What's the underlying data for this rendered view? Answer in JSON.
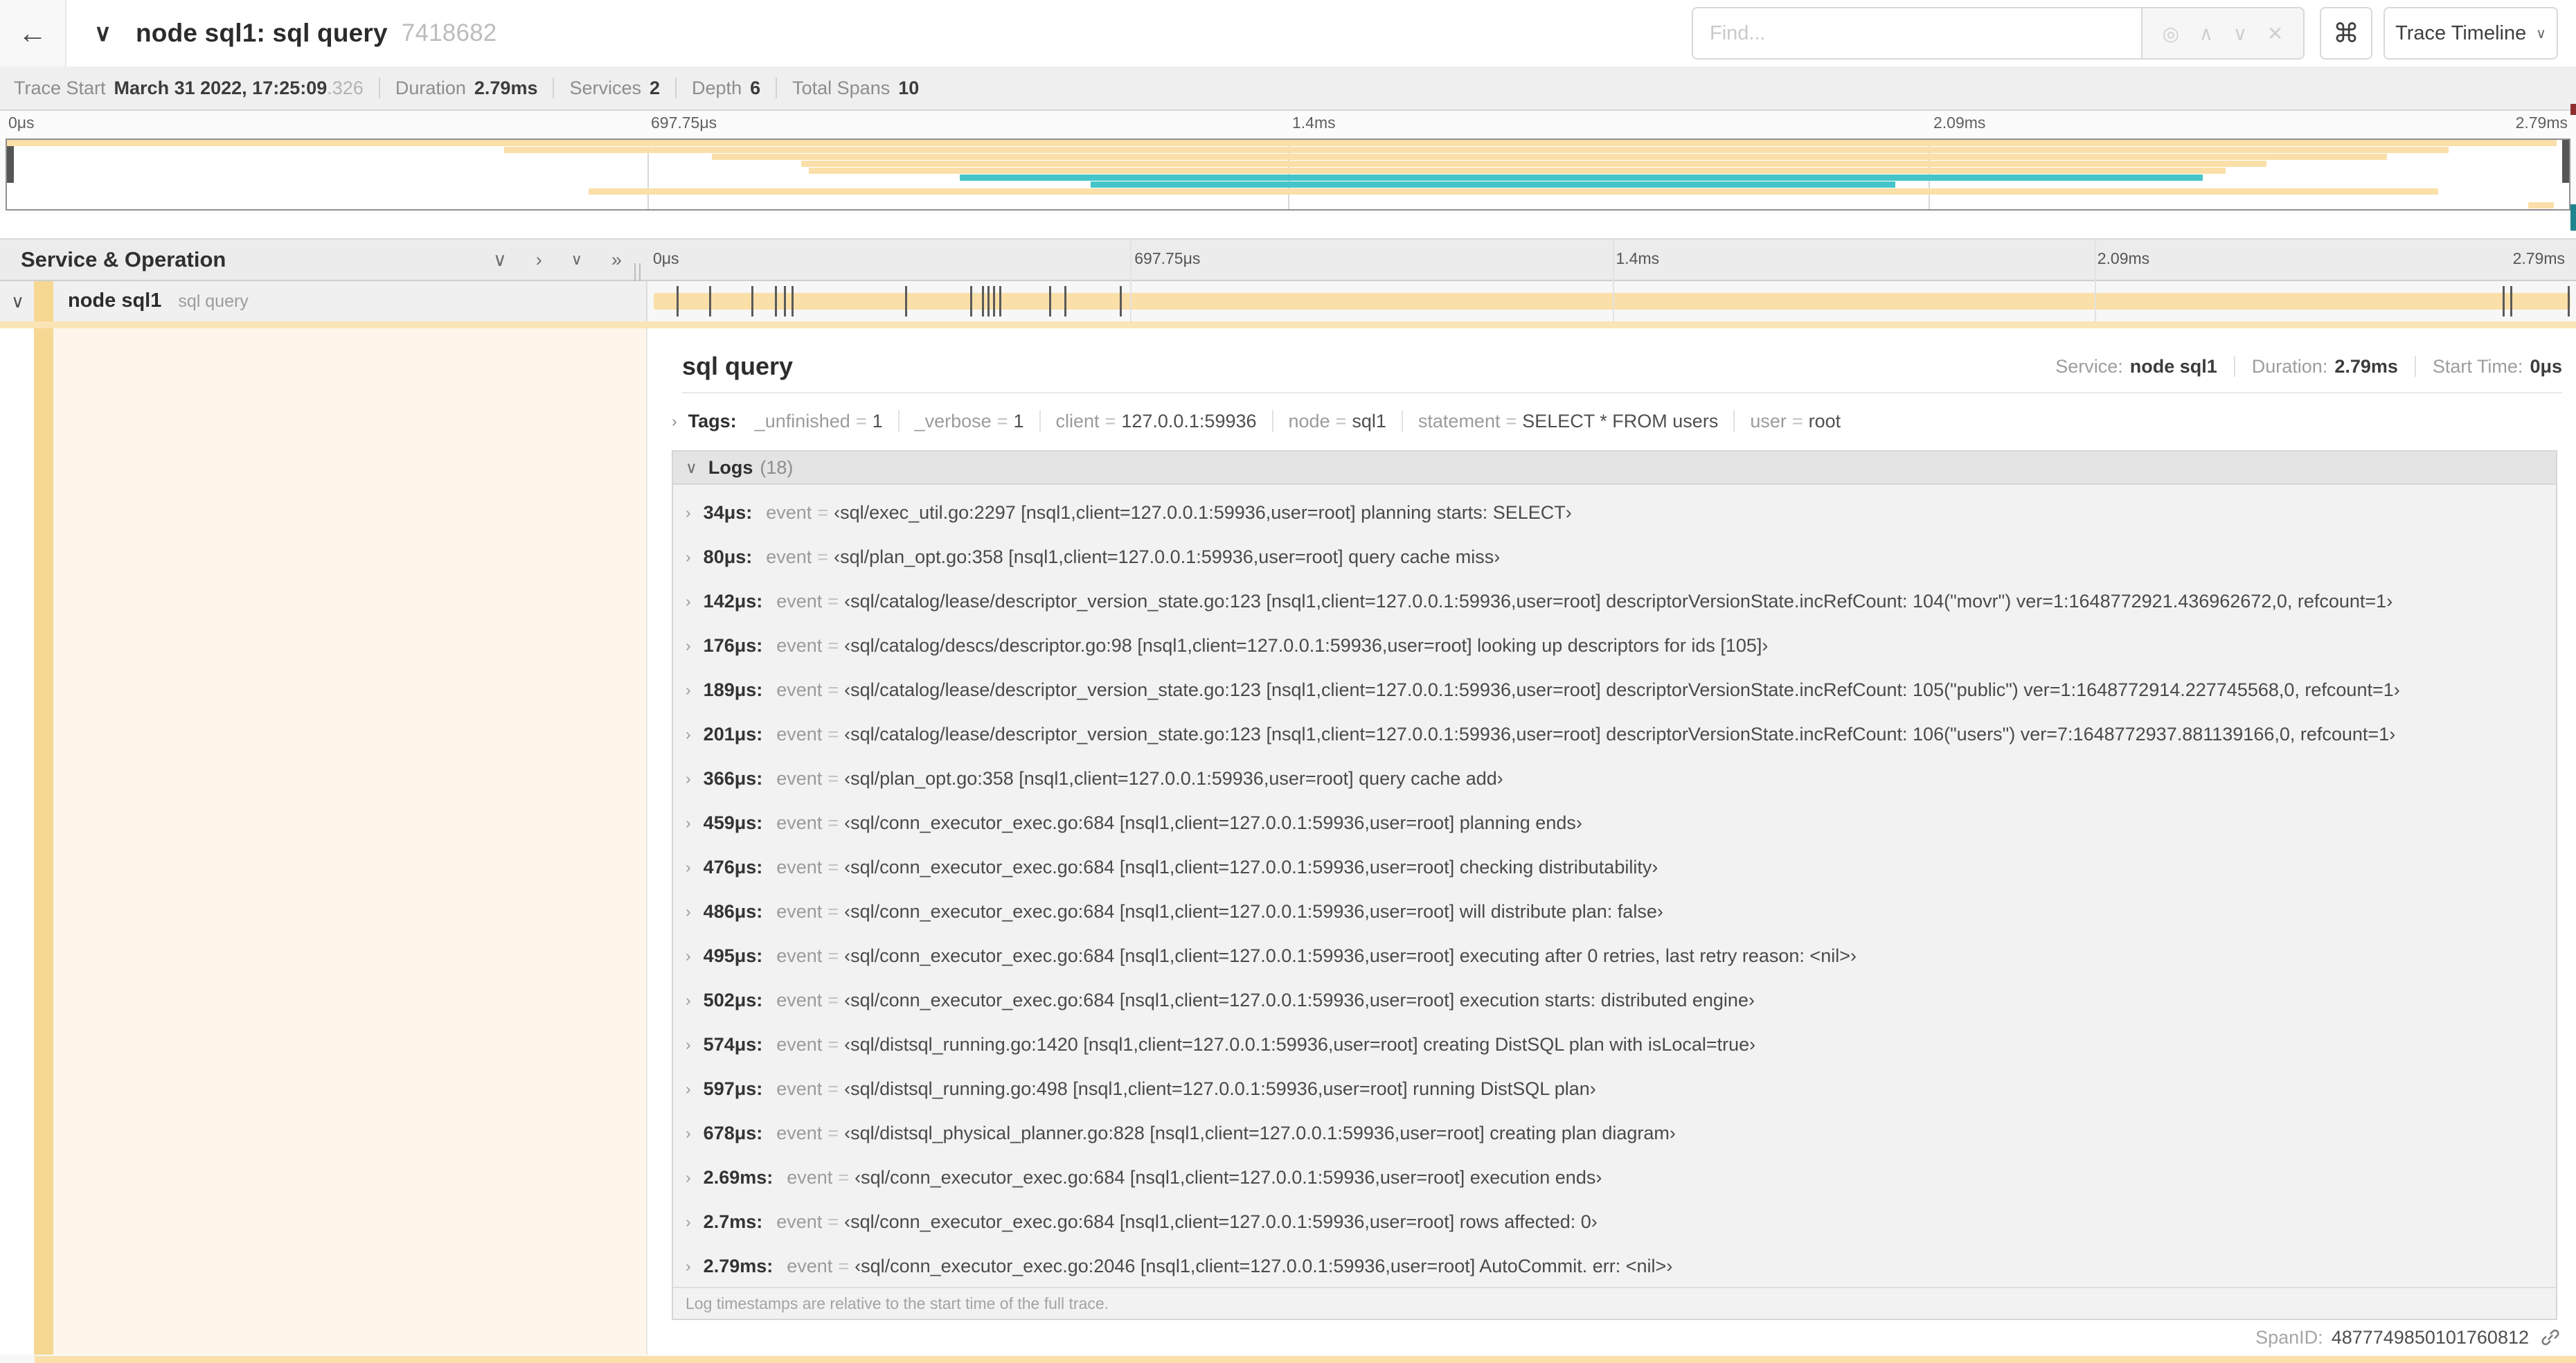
{
  "colors": {
    "yellow": "#fadfa9",
    "strip_yellow": "#f6d893",
    "teal": "#45c5c9",
    "cream": "#fff5ea"
  },
  "header": {
    "back_icon": "←",
    "collapse_icon": "∨",
    "title": "node sql1: sql query",
    "trace_id": "7418682",
    "find_placeholder": "Find...",
    "find_icons": [
      "◎",
      "∧",
      "∨",
      "✕"
    ],
    "shortcut_label": "⌘",
    "view_label": "Trace Timeline",
    "view_caret": "∨"
  },
  "summary": {
    "items": [
      {
        "label": "Trace Start",
        "value": "March 31 2022, 17:25:09",
        "suffix": ".326"
      },
      {
        "label": "Duration",
        "value": "2.79ms"
      },
      {
        "label": "Services",
        "value": "2"
      },
      {
        "label": "Depth",
        "value": "6"
      },
      {
        "label": "Total Spans",
        "value": "10"
      }
    ]
  },
  "minimap": {
    "ticks": [
      "0μs",
      "697.75μs",
      "1.4ms",
      "2.09ms",
      "2.79ms"
    ],
    "spans": [
      {
        "row": 0,
        "start": 0,
        "end": 99.5,
        "color": "yellow"
      },
      {
        "row": 1,
        "start": 19.4,
        "end": 95.3,
        "color": "yellow"
      },
      {
        "row": 2,
        "start": 27.5,
        "end": 92.9,
        "color": "yellow"
      },
      {
        "row": 3,
        "start": 31.0,
        "end": 88.2,
        "color": "yellow"
      },
      {
        "row": 4,
        "start": 31.3,
        "end": 86.6,
        "color": "yellow"
      },
      {
        "row": 5,
        "start": 37.2,
        "end": 85.7,
        "color": "teal"
      },
      {
        "row": 6,
        "start": 42.3,
        "end": 73.7,
        "color": "teal"
      },
      {
        "row": 7,
        "start": 22.7,
        "end": 94.9,
        "color": "yellow"
      },
      {
        "row": 9,
        "start": 98.4,
        "end": 99.4,
        "color": "yellow"
      }
    ]
  },
  "timeline": {
    "column_header": "Service & Operation",
    "collapse_icons": [
      "∨",
      "›",
      "∨∨",
      "»"
    ],
    "ticks": [
      "0μs",
      "697.75μs",
      "1.4ms",
      "2.09ms",
      "2.79ms"
    ],
    "row": {
      "collapse_icon": "∨",
      "service": "node sql1",
      "operation": "sql query"
    },
    "log_markers": [
      1.2,
      2.9,
      5.1,
      6.3,
      6.8,
      7.2,
      13.1,
      16.5,
      17.1,
      17.4,
      17.7,
      18.0,
      20.6,
      21.4,
      24.3,
      96.4,
      96.8,
      99.8
    ]
  },
  "detail": {
    "title": "sql query",
    "meta": [
      {
        "label": "Service:",
        "value": "node sql1"
      },
      {
        "label": "Duration:",
        "value": "2.79ms"
      },
      {
        "label": "Start Time:",
        "value": "0μs"
      }
    ],
    "tags": {
      "chevron": "›",
      "label": "Tags:",
      "items": [
        {
          "key": "_unfinished",
          "value": "1"
        },
        {
          "key": "_verbose",
          "value": "1"
        },
        {
          "key": "client",
          "value": "127.0.0.1:59936"
        },
        {
          "key": "node",
          "value": "sql1"
        },
        {
          "key": "statement",
          "value": "SELECT * FROM users"
        },
        {
          "key": "user",
          "value": "root"
        }
      ]
    },
    "logs": {
      "chevron": "∨",
      "label": "Logs",
      "count": "(18)",
      "entry_chevron": "›",
      "entry_key": "event",
      "entries": [
        {
          "time": "34μs:",
          "value": "‹sql/exec_util.go:2297 [nsql1,client=127.0.0.1:59936,user=root] planning starts: SELECT›"
        },
        {
          "time": "80μs:",
          "value": "‹sql/plan_opt.go:358 [nsql1,client=127.0.0.1:59936,user=root] query cache miss›"
        },
        {
          "time": "142μs:",
          "value": "‹sql/catalog/lease/descriptor_version_state.go:123 [nsql1,client=127.0.0.1:59936,user=root] descriptorVersionState.incRefCount: 104(\"movr\") ver=1:1648772921.436962672,0, refcount=1›"
        },
        {
          "time": "176μs:",
          "value": "‹sql/catalog/descs/descriptor.go:98 [nsql1,client=127.0.0.1:59936,user=root] looking up descriptors for ids [105]›"
        },
        {
          "time": "189μs:",
          "value": "‹sql/catalog/lease/descriptor_version_state.go:123 [nsql1,client=127.0.0.1:59936,user=root] descriptorVersionState.incRefCount: 105(\"public\") ver=1:1648772914.227745568,0, refcount=1›"
        },
        {
          "time": "201μs:",
          "value": "‹sql/catalog/lease/descriptor_version_state.go:123 [nsql1,client=127.0.0.1:59936,user=root] descriptorVersionState.incRefCount: 106(\"users\") ver=7:1648772937.881139166,0, refcount=1›"
        },
        {
          "time": "366μs:",
          "value": "‹sql/plan_opt.go:358 [nsql1,client=127.0.0.1:59936,user=root] query cache add›"
        },
        {
          "time": "459μs:",
          "value": "‹sql/conn_executor_exec.go:684 [nsql1,client=127.0.0.1:59936,user=root] planning ends›"
        },
        {
          "time": "476μs:",
          "value": "‹sql/conn_executor_exec.go:684 [nsql1,client=127.0.0.1:59936,user=root] checking distributability›"
        },
        {
          "time": "486μs:",
          "value": "‹sql/conn_executor_exec.go:684 [nsql1,client=127.0.0.1:59936,user=root] will distribute plan: false›"
        },
        {
          "time": "495μs:",
          "value": "‹sql/conn_executor_exec.go:684 [nsql1,client=127.0.0.1:59936,user=root] executing after 0 retries, last retry reason: <nil>›"
        },
        {
          "time": "502μs:",
          "value": "‹sql/conn_executor_exec.go:684 [nsql1,client=127.0.0.1:59936,user=root] execution starts: distributed engine›"
        },
        {
          "time": "574μs:",
          "value": "‹sql/distsql_running.go:1420 [nsql1,client=127.0.0.1:59936,user=root] creating DistSQL plan with isLocal=true›"
        },
        {
          "time": "597μs:",
          "value": "‹sql/distsql_running.go:498 [nsql1,client=127.0.0.1:59936,user=root] running DistSQL plan›"
        },
        {
          "time": "678μs:",
          "value": "‹sql/distsql_physical_planner.go:828 [nsql1,client=127.0.0.1:59936,user=root] creating plan diagram›"
        },
        {
          "time": "2.69ms:",
          "value": "‹sql/conn_executor_exec.go:684 [nsql1,client=127.0.0.1:59936,user=root] execution ends›"
        },
        {
          "time": "2.7ms:",
          "value": "‹sql/conn_executor_exec.go:684 [nsql1,client=127.0.0.1:59936,user=root] rows affected: 0›"
        },
        {
          "time": "2.79ms:",
          "value": "‹sql/conn_executor_exec.go:2046 [nsql1,client=127.0.0.1:59936,user=root] AutoCommit. err: <nil>›"
        }
      ],
      "note": "Log timestamps are relative to the start time of the full trace."
    },
    "footer": {
      "label": "SpanID:",
      "value": "4877749850101760812"
    }
  }
}
